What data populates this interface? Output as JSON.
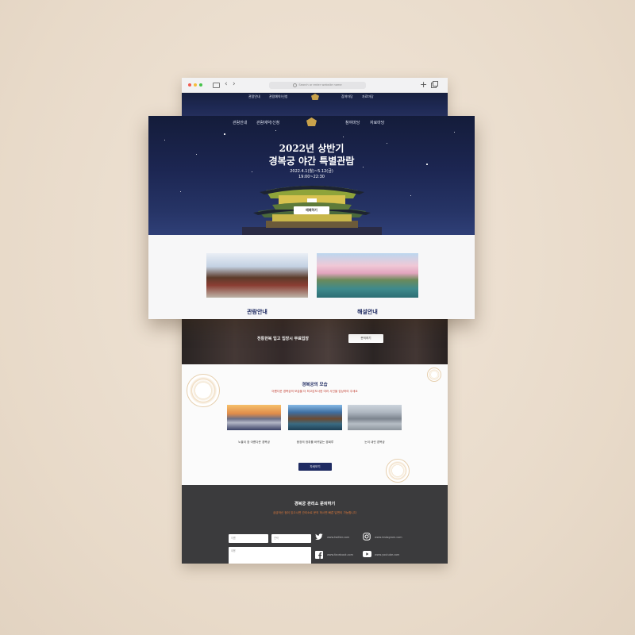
{
  "browser": {
    "url_placeholder": "Search or enter website name",
    "plus_label": "+"
  },
  "nav": {
    "items_left": [
      "관람안내",
      "관람예약/신청"
    ],
    "items_right": [
      "참여마당",
      "자료마당"
    ]
  },
  "hero": {
    "title_line1": "2022년 상반기",
    "title_line2": "경복궁 야간 특별관람",
    "date": "2022.4.1(월)~5.12(금)",
    "time": "19:00~22:30",
    "reserve_label": "예매하기"
  },
  "cards": [
    {
      "label": "관람안내"
    },
    {
      "label": "해설안내"
    }
  ],
  "culture": {
    "text": "전통한복 입고 입장시 무료입장",
    "button": "문의하기"
  },
  "palace_section": {
    "title": "경복궁의 모습",
    "subtitle": "아름다운 경복궁의 모습을 더 최고감도사한 여러 사진을 감상하여 주세요",
    "captions": [
      "노을이 참 아름다운 경복궁",
      "웅장의 정취를 바퀴없는 경회루",
      "눈이 내린 경복궁"
    ],
    "more_label": "자세보기"
  },
  "contact": {
    "title": "경복궁 관리소 문의하기",
    "subtitle": "궁금하신 점이 있으시면 관리소로 문의 하시면 빠른 답변이 가능합니다",
    "field_name": "이름",
    "field_phone": "연락",
    "field_message": "내용",
    "social": {
      "twitter": "www.twitter.com",
      "instagram": "www.instagram.com",
      "facebook": "www.facebook.com",
      "youtube": "www.youtube.com"
    }
  },
  "colors": {
    "navy": "#1f2b62",
    "accent_red": "#c0392b",
    "accent_orange": "#e07a3b",
    "gold": "#c9a24b",
    "footer_gray": "#3b3b3d"
  }
}
